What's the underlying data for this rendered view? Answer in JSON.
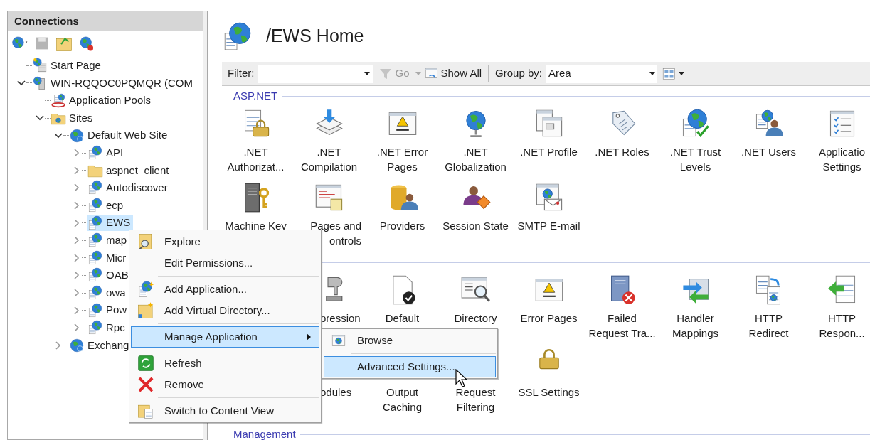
{
  "connections": {
    "title": "Connections",
    "tree": [
      {
        "label": "Start Page",
        "kind": "page",
        "selected": false
      },
      {
        "label": "WIN-RQQOC0PQMQR (COM",
        "kind": "server",
        "selected": false,
        "expanded": true,
        "children": [
          {
            "label": "Application Pools",
            "kind": "pools",
            "selected": false
          },
          {
            "label": "Sites",
            "kind": "sites",
            "selected": false,
            "expanded": true,
            "children": [
              {
                "label": "Default Web Site",
                "kind": "site",
                "selected": false,
                "expanded": true,
                "children": [
                  {
                    "label": "API",
                    "kind": "application",
                    "selected": false,
                    "expanded": false
                  },
                  {
                    "label": "aspnet_client",
                    "kind": "folder",
                    "selected": false,
                    "expanded": false
                  },
                  {
                    "label": "Autodiscover",
                    "kind": "application",
                    "selected": false,
                    "expanded": false
                  },
                  {
                    "label": "ecp",
                    "kind": "application",
                    "selected": false,
                    "expanded": false
                  },
                  {
                    "label": "EWS",
                    "kind": "application",
                    "selected": true,
                    "expanded": false
                  },
                  {
                    "label": "map",
                    "kind": "application",
                    "selected": false,
                    "expanded": false
                  },
                  {
                    "label": "Micr",
                    "kind": "application",
                    "selected": false,
                    "expanded": false
                  },
                  {
                    "label": "OAB",
                    "kind": "application",
                    "selected": false,
                    "expanded": false
                  },
                  {
                    "label": "owa",
                    "kind": "application",
                    "selected": false,
                    "expanded": false
                  },
                  {
                    "label": "Pow",
                    "kind": "application",
                    "selected": false,
                    "expanded": false
                  },
                  {
                    "label": "Rpc",
                    "kind": "application",
                    "selected": false,
                    "expanded": false
                  }
                ]
              },
              {
                "label": "Exchang",
                "kind": "site",
                "selected": false,
                "expanded": false
              }
            ]
          }
        ]
      }
    ]
  },
  "page": {
    "title": "/EWS Home",
    "filter_bar": {
      "filter_label": "Filter:",
      "go": {
        "label": "Go",
        "disabled": true
      },
      "show_all": "Show All",
      "group_by_label": "Group by:",
      "group_by_value": "Area"
    },
    "sections": [
      {
        "title": "ASP.NET",
        "items": [
          {
            "label": ".NET\nAuthorizat...",
            "kind": "full"
          },
          {
            "label": ".NET\nCompilation",
            "kind": "full"
          },
          {
            "label": ".NET Error\nPages",
            "kind": "full"
          },
          {
            "label": ".NET\nGlobalization",
            "kind": "full"
          },
          {
            "label": ".NET Profile",
            "kind": "full"
          },
          {
            "label": ".NET Roles",
            "kind": "full"
          },
          {
            "label": ".NET Trust\nLevels",
            "kind": "full"
          },
          {
            "label": ".NET Users",
            "kind": "full"
          },
          {
            "label": "Applicatio\nSettings",
            "kind": "full"
          },
          {
            "label": "Machine Key",
            "kind": "full"
          },
          {
            "label": "Pages and\nontrols",
            "kind": "clipped"
          },
          {
            "label": "Providers",
            "kind": "full"
          },
          {
            "label": "Session State",
            "kind": "full"
          },
          {
            "label": "SMTP E-mail",
            "kind": "full"
          }
        ]
      },
      {
        "items": [
          {
            "label": "pression",
            "kind": "partial"
          },
          {
            "label": "Default",
            "kind": "full"
          },
          {
            "label": "Directory",
            "kind": "full"
          },
          {
            "label": "Error Pages",
            "kind": "full"
          },
          {
            "label": "Failed\nRequest Tra...",
            "kind": "full"
          },
          {
            "label": "Handler\nMappings",
            "kind": "full"
          },
          {
            "label": "HTTP\nRedirect",
            "kind": "full"
          },
          {
            "label": "HTTP\nRespon...",
            "kind": "full"
          },
          {
            "label": "odules",
            "kind": "partial"
          },
          {
            "label": "Output\nCaching",
            "kind": "full"
          },
          {
            "label": "Request\nFiltering",
            "kind": "full"
          },
          {
            "label": "SSL Settings",
            "kind": "full"
          }
        ]
      },
      {
        "title": "Management"
      }
    ]
  },
  "context_menu": {
    "groups": [
      [
        {
          "label": "Explore",
          "selected": false
        },
        {
          "label": "Edit Permissions...",
          "selected": false
        }
      ],
      [
        {
          "label": "Add Application...",
          "selected": false
        },
        {
          "label": "Add Virtual Directory...",
          "selected": false
        }
      ],
      [
        {
          "label": "Manage Application",
          "selected": true,
          "has_submenu": true
        }
      ],
      [
        {
          "label": "Refresh",
          "selected": false
        },
        {
          "label": "Remove",
          "selected": false
        }
      ],
      [
        {
          "label": "Switch to Content View",
          "selected": false
        }
      ]
    ]
  },
  "submenu": {
    "groups": [
      [
        {
          "label": "Browse",
          "selected": false
        }
      ],
      [
        {
          "label": "Advanced Settings...",
          "selected": true
        }
      ]
    ]
  }
}
